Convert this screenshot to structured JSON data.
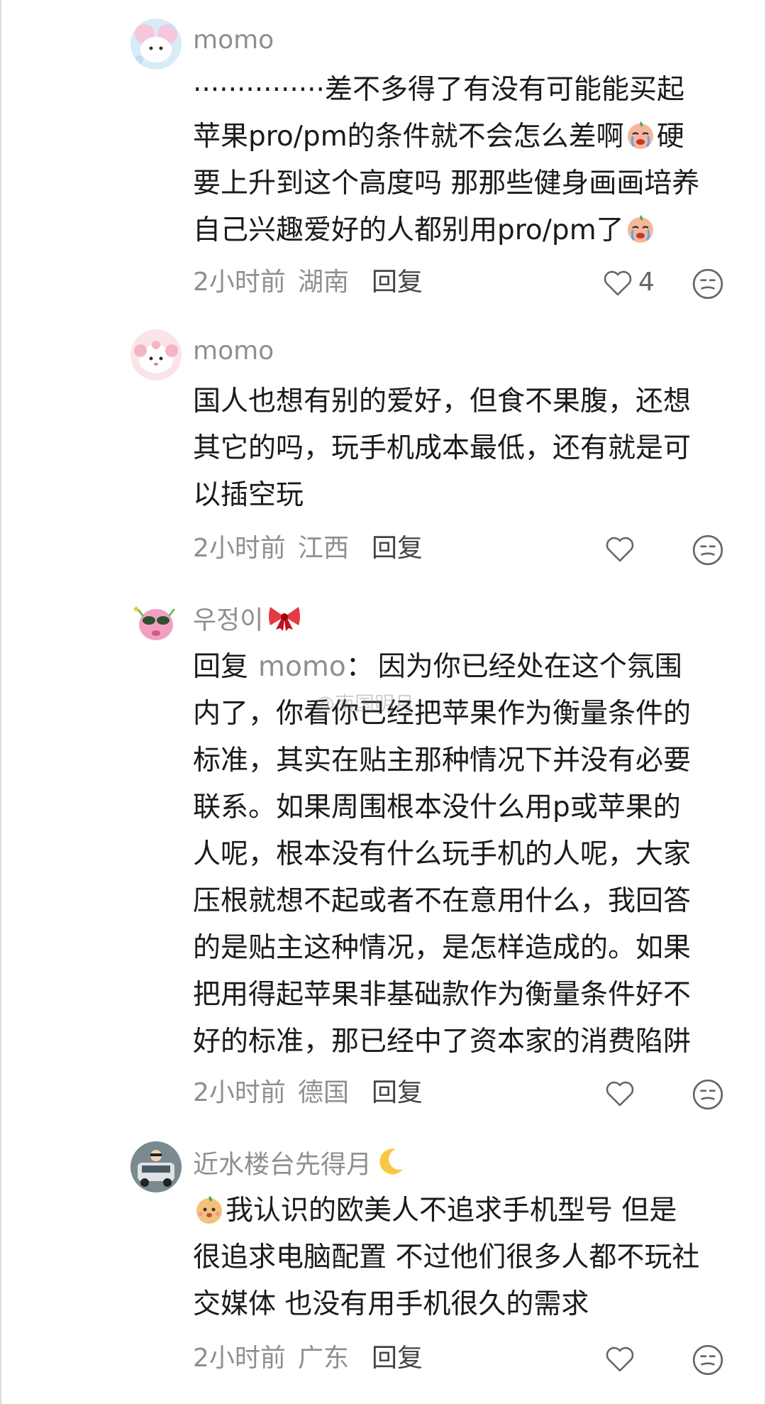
{
  "comments": [
    {
      "username": "momo",
      "lines": [
        "···············差不多得了有没有可能能买起",
        "苹果pro/pm的条件就不会怎么差啊",
        "要上升到这个高度吗 那那些健身画画培养",
        "自己兴趣爱好的人都别用pro/pm了"
      ],
      "line2_tail": "硬",
      "time": "2小时前",
      "location": "湖南",
      "reply": "回复",
      "likes": "4"
    },
    {
      "username": "momo",
      "lines": [
        "国人也想有别的爱好，但食不果腹，还想",
        "其它的吗，玩手机成本最低，还有就是可",
        "以插空玩"
      ],
      "time": "2小时前",
      "location": "江西",
      "reply": "回复"
    },
    {
      "username": "우정이",
      "reply_prefix": "回复",
      "reply_target": "momo",
      "reply_colon": "：",
      "lines": [
        "因为你已经处在这个氛围",
        "内了，你看你已经把苹果作为衡量条件的",
        "标准，其实在贴主那种情况下并没有必要",
        "联系。如果周围根本没什么用p或苹果的",
        "人呢，根本没有什么玩手机的人呢，大家",
        "压根就想不起或者不在意用什么，我回答",
        "的是贴主这种情况，是怎样造成的。如果",
        "把用得起苹果非基础款作为衡量条件好不",
        "好的标准，那已经中了资本家的消费陷阱"
      ],
      "time": "2小时前",
      "location": "德国",
      "reply": "回复"
    },
    {
      "username": "近水楼台先得月",
      "lines": [
        "我认识的欧美人不追求手机型号 但是",
        "很追求电脑配置 不过他们很多人都不玩社",
        "交媒体 也没有用手机很久的需求"
      ],
      "time": "2小时前",
      "location": "广东",
      "reply": "回复"
    }
  ],
  "watermark": "@南国明月",
  "icons": {
    "like": "heart-outline-icon",
    "dislike": "meh-face-icon"
  },
  "colors": {
    "username": "#8f8f8f",
    "text": "#1b1b1b",
    "meta": "#8f8f8f"
  }
}
